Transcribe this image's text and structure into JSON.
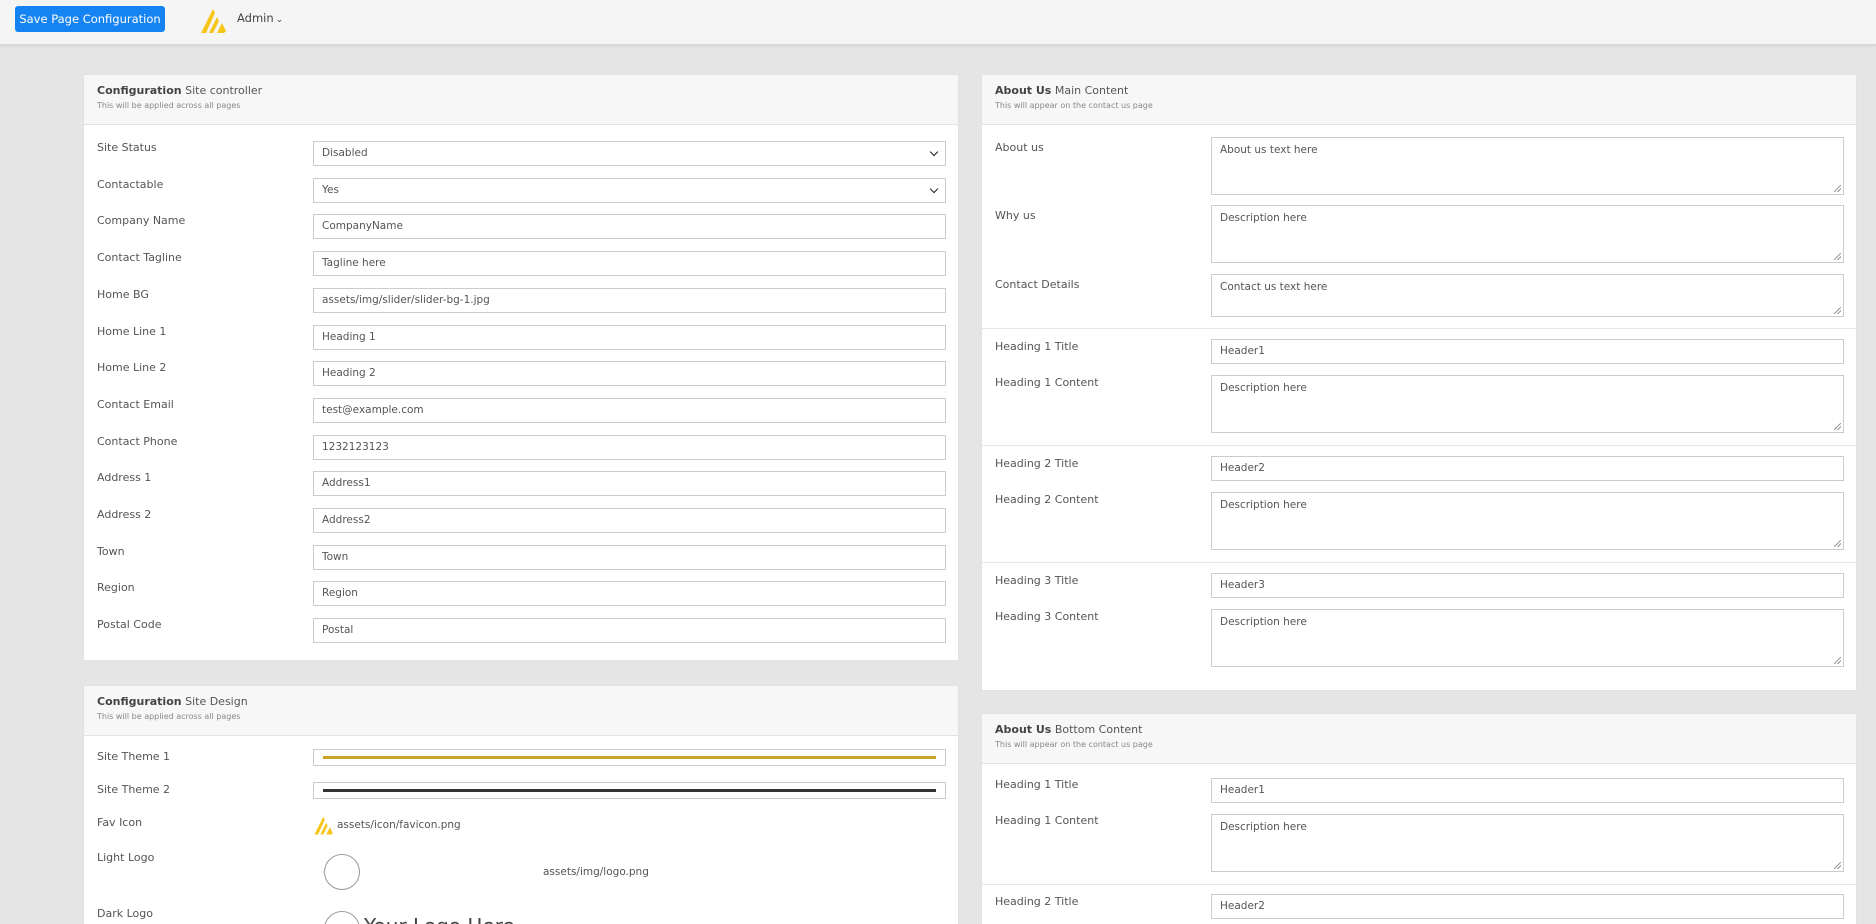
{
  "header": {
    "save_label": "Save Page Configuration",
    "user_label": "Admin"
  },
  "site_controller": {
    "title_bold": "Configuration",
    "title_rest": " Site controller",
    "subtitle": "This will be applied across all pages",
    "fields": [
      {
        "label": "Site Status",
        "value": "Disabled",
        "type": "select"
      },
      {
        "label": "Contactable",
        "value": "Yes",
        "type": "select"
      },
      {
        "label": "Company Name",
        "value": "CompanyName",
        "type": "text"
      },
      {
        "label": "Contact Tagline",
        "value": "Tagline here",
        "type": "text"
      },
      {
        "label": "Home BG",
        "value": "assets/img/slider/slider-bg-1.jpg",
        "type": "text"
      },
      {
        "label": "Home Line 1",
        "value": "Heading 1",
        "type": "text"
      },
      {
        "label": "Home Line 2",
        "value": "Heading 2",
        "type": "text"
      },
      {
        "label": "Contact Email",
        "value": "test@example.com",
        "type": "text"
      },
      {
        "label": "Contact Phone",
        "value": "1232123123",
        "type": "text"
      },
      {
        "label": "Address 1",
        "value": "Address1",
        "type": "text"
      },
      {
        "label": "Address 2",
        "value": "Address2",
        "type": "text"
      },
      {
        "label": "Town",
        "value": "Town",
        "type": "text"
      },
      {
        "label": "Region",
        "value": "Region",
        "type": "text"
      },
      {
        "label": "Postal Code",
        "value": "Postal",
        "type": "text"
      }
    ]
  },
  "site_design": {
    "title_bold": "Configuration",
    "title_rest": " Site Design",
    "subtitle": "This will be applied across all pages",
    "theme1_label": "Site Theme 1",
    "theme1_color": "#c9a227",
    "theme2_label": "Site Theme 2",
    "theme2_color": "#333333",
    "fav_label": "Fav Icon",
    "fav_value": "assets/icon/favicon.png",
    "light_logo_label": "Light Logo",
    "light_logo_value": "assets/img/logo.png",
    "dark_logo_label": "Dark Logo",
    "dark_logo_text": "Your Logo Here"
  },
  "about_main": {
    "title_bold": "About Us",
    "title_rest": " Main Content",
    "subtitle": "This will appear on the contact us page",
    "about_label": "About us",
    "about_value": "About us text here",
    "why_label": "Why us",
    "why_value": "Description here",
    "contact_label": "Contact Details",
    "contact_value": "Contact us text here",
    "headings": [
      {
        "title_label": "Heading 1 Title",
        "title_value": "Header1",
        "content_label": "Heading 1 Content",
        "content_value": "Description here"
      },
      {
        "title_label": "Heading 2 Title",
        "title_value": "Header2",
        "content_label": "Heading 2 Content",
        "content_value": "Description here"
      },
      {
        "title_label": "Heading 3 Title",
        "title_value": "Header3",
        "content_label": "Heading 3 Content",
        "content_value": "Description here"
      }
    ]
  },
  "about_bottom": {
    "title_bold": "About Us",
    "title_rest": " Bottom Content",
    "subtitle": "This will appear on the contact us page",
    "h1_title_label": "Heading 1 Title",
    "h1_title_value": "Header1",
    "h1_content_label": "Heading 1 Content",
    "h1_content_value": "Description here",
    "h2_title_label": "Heading 2 Title",
    "h2_title_value": "Header2"
  },
  "colors": {
    "primary": "#1683f2",
    "logo_yellow": "#f5c518"
  }
}
